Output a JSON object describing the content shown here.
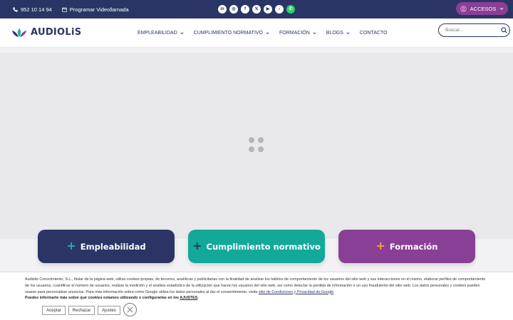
{
  "topbar": {
    "phone": "952 10 14 94",
    "schedule": "Programar Videollamada",
    "socials": [
      {
        "name": "linkedin-icon",
        "glyph": "in"
      },
      {
        "name": "instagram-icon",
        "glyph": "◎"
      },
      {
        "name": "facebook-icon",
        "glyph": "f"
      },
      {
        "name": "x-icon",
        "glyph": "𝕏"
      },
      {
        "name": "youtube-icon",
        "glyph": "▶"
      },
      {
        "name": "tiktok-icon",
        "glyph": "♪"
      },
      {
        "name": "whatsapp-icon",
        "glyph": "✆"
      }
    ],
    "access_label": "ACCESOS"
  },
  "header": {
    "logo": "AUDIOLiS",
    "nav": [
      {
        "label": "EMPLEABILIDAD",
        "dropdown": true
      },
      {
        "label": "CUMPLIMIENTO NORMATIVO",
        "dropdown": true
      },
      {
        "label": "FORMACIÓN",
        "dropdown": true
      },
      {
        "label": "BLOGS",
        "dropdown": true
      },
      {
        "label": "CONTACTO",
        "dropdown": false
      }
    ],
    "search_placeholder": "Buscar..."
  },
  "cards": [
    {
      "label": "Empleabilidad",
      "bg": "#2a3566",
      "plus_color": "#22b3a5"
    },
    {
      "label": "Cumplimiento normativo",
      "bg": "#12a99a",
      "plus_color": "#2a3566"
    },
    {
      "label": "Formación",
      "bg": "#8a3f96",
      "plus_color": "#f2a23a"
    }
  ],
  "cookie": {
    "text": "Audiolis Conocimiento, S.L., titular de la página web, utiliza cookies propias, de terceros, analíticas y publicitarias con la finalidad de analizar los hábitos de comportamiento de los usuarios del sitio web y sus interacciones en el mismo, elaborar perfiles de comportamiento de los usuarios, cuantificar el número de usuarios, realizar la medición y el análisis estadístico de la utilización que hacen los usuarios del sitio web, así como detectar la pérdida de información o un uso fraudulento del sitio web. Los datos personales y cookies pueden usarse para personalizar anuncios. Para más información sobre cómo Google utiliza los datos personales al dar el consentimiento, visita",
    "google_link": "sitio de Condiciones y Privacidad de Google",
    "more_info": "Puedes informarte más sobre qué cookies estamos utilizando o configurarlas en los",
    "settings_link": "AJUSTES",
    "accept": "Aceptar",
    "reject": "Rechazar",
    "settings": "Ajustes"
  },
  "colors": {
    "navy": "#2a3566",
    "teal": "#12a99a",
    "purple": "#8a3f96"
  }
}
